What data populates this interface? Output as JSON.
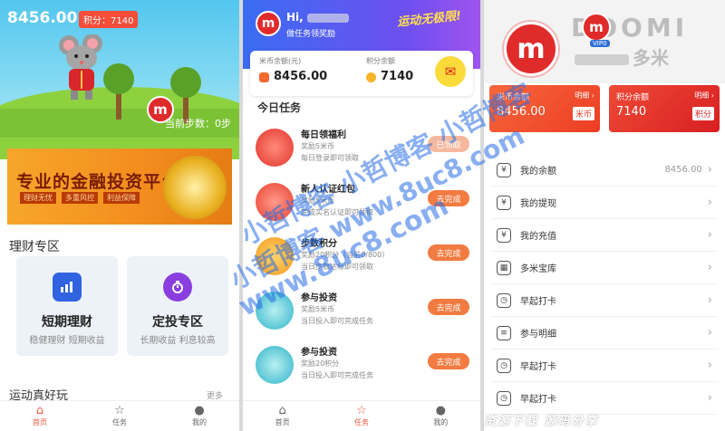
{
  "panel1": {
    "balance": "8456.00",
    "score_pill": "积分：7140",
    "steps_text": "当前步数：0步",
    "logo_letter": "m",
    "banner": {
      "title": "专业的金融投资平台",
      "tags": [
        "理财无忧",
        "多重风控",
        "利益保障"
      ]
    },
    "section_title": "理财专区",
    "cards": [
      {
        "title": "短期理财",
        "sub": "稳健理财 短期收益"
      },
      {
        "title": "定投专区",
        "sub": "长期收益 利息较高"
      }
    ],
    "section2_title": "运动真好玩",
    "section2_more": "更多",
    "tabs": [
      {
        "icon": "⌂",
        "label": "首页"
      },
      {
        "icon": "☆",
        "label": "任务"
      },
      {
        "icon": "●",
        "label": "我的"
      }
    ]
  },
  "panel2": {
    "greeting": "Hi,",
    "sub": "做任务领奖励",
    "slogan": "运动无极限!",
    "logo_letter": "m",
    "balances": [
      {
        "label": "米币余额(元)",
        "value": "8456.00"
      },
      {
        "label": "积分余额",
        "value": "7140"
      }
    ],
    "task_header": "今日任务",
    "tasks": [
      {
        "title": "每日领福利",
        "line1": "奖励5米币",
        "line2": "每日登录即可领取",
        "button": "已领取"
      },
      {
        "title": "新人认证红包",
        "line1": "奖励5米币",
        "line2": "完成实名认证即可领取",
        "button": "去完成"
      },
      {
        "title": "步数积分",
        "line1": "奖励20积分（当前0/800）",
        "line2": "当日步数达标即可领取",
        "button": "去完成"
      },
      {
        "title": "参与投资",
        "line1": "奖励5米币",
        "line2": "当日投入即可完成任务",
        "button": "去完成"
      },
      {
        "title": "参与投资",
        "line1": "奖励20积分",
        "line2": "当日投入即可完成任务",
        "button": "去完成"
      }
    ],
    "tabs": [
      {
        "icon": "⌂",
        "label": "首页"
      },
      {
        "icon": "☆",
        "label": "任务"
      },
      {
        "icon": "●",
        "label": "我的"
      }
    ]
  },
  "panel3": {
    "brand": "DOOMI",
    "brand_cn": "多米",
    "vip": "VIP0",
    "logo_letter": "m",
    "accounts": [
      {
        "label": "米币余额",
        "value": "8456.00",
        "more": "明细 ›",
        "badge": "米币",
        "color": "#f04f2e"
      },
      {
        "label": "积分余额",
        "value": "7140",
        "more": "明细 ›",
        "badge": "积分",
        "color": "#e6352b"
      }
    ],
    "menu": [
      {
        "icon": "¥",
        "label": "我的余额",
        "value": "8456.00"
      },
      {
        "icon": "¥",
        "label": "我的提现",
        "value": ""
      },
      {
        "icon": "¥",
        "label": "我的充值",
        "value": ""
      },
      {
        "icon": "▦",
        "label": "多米宝库",
        "value": ""
      },
      {
        "icon": "◷",
        "label": "早起打卡",
        "value": ""
      },
      {
        "icon": "≡",
        "label": "参与明细",
        "value": ""
      },
      {
        "icon": "◷",
        "label": "早起打卡",
        "value": ""
      },
      {
        "icon": "◷",
        "label": "早起打卡",
        "value": ""
      }
    ]
  },
  "watermark": {
    "line1": "小哲博客 小哲博客 小哲博客",
    "line2": "小哲博客 www.8uc8.com",
    "line3": "www.8uc8.com"
  },
  "bottom_strip": "资源下载 源码分享"
}
